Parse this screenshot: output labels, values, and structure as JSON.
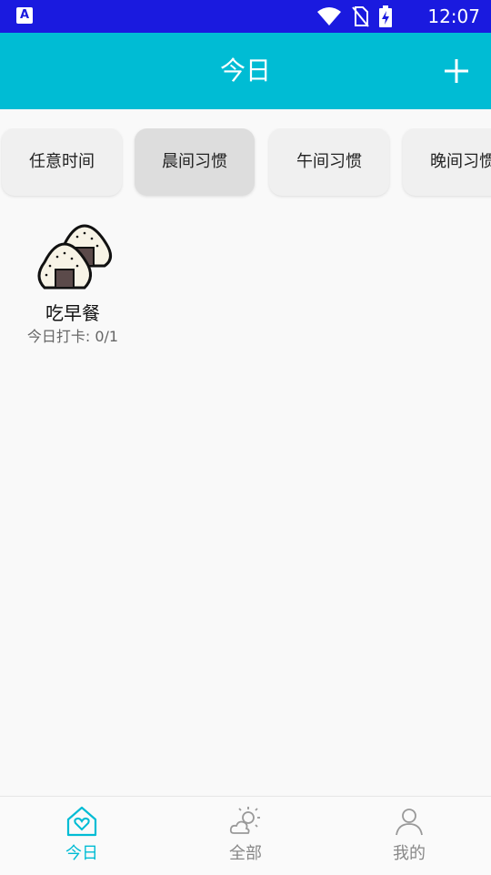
{
  "status_bar": {
    "app_icon_label": "A",
    "time": "12:07",
    "icons": [
      "wifi-icon",
      "no-sim-icon",
      "battery-charging-icon"
    ]
  },
  "header": {
    "title": "今日",
    "add_icon": "plus-icon"
  },
  "chips": [
    {
      "label": "任意时间",
      "selected": false
    },
    {
      "label": "晨间习惯",
      "selected": true
    },
    {
      "label": "午间习惯",
      "selected": false
    },
    {
      "label": "晚间习惯",
      "selected": false
    }
  ],
  "habits": [
    {
      "name": "吃早餐",
      "progress": "今日打卡: 0/1",
      "icon": "rice-ball-icon"
    }
  ],
  "bottom_nav": [
    {
      "label": "今日",
      "icon": "home-heart-icon",
      "active": true
    },
    {
      "label": "全部",
      "icon": "sun-cloud-icon",
      "active": false
    },
    {
      "label": "我的",
      "icon": "profile-icon",
      "active": false
    }
  ],
  "colors": {
    "status_bar": "#1a1adf",
    "accent": "#00bcd4",
    "background": "#f9f9f9"
  }
}
